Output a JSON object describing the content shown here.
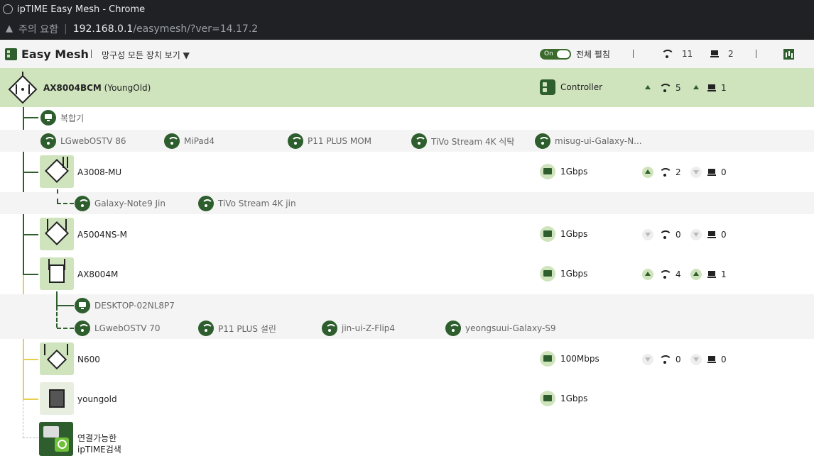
{
  "browser": {
    "window_title": "ipTIME Easy Mesh - Chrome",
    "security_label": "주의 요함",
    "url_host": "192.168.0.1",
    "url_path": "/easymesh/?ver=14.17.2"
  },
  "header": {
    "app_title": "Easy Mesh",
    "view_all_label": "망구성 모든 장치 보기 ▼",
    "toggle_label": "On",
    "expand_label": "전체 펼침",
    "wifi_total": "11",
    "wired_total": "2"
  },
  "controller": {
    "model": "AX8004BCM",
    "name": "(YoungOld)",
    "role": "Controller",
    "wifi_count": "5",
    "wired_count": "1"
  },
  "controller_clients": {
    "wired": [
      "복합기"
    ],
    "wifi": [
      "LGwebOSTV 86",
      "MiPad4",
      "P11 PLUS MOM",
      "TiVo Stream 4K 식탁",
      "misug-ui-Galaxy-N..."
    ]
  },
  "agents": [
    {
      "model": "A3008-MU",
      "link": "1Gbps",
      "wifi": "2",
      "wired": "0",
      "wifi_up": true,
      "wired_up": false,
      "clients_wired": [],
      "clients_wifi": [
        "Galaxy-Note9 Jin",
        "TiVo Stream 4K jin"
      ]
    },
    {
      "model": "A5004NS-M",
      "link": "1Gbps",
      "wifi": "0",
      "wired": "0",
      "wifi_up": false,
      "wired_up": false,
      "clients_wired": [],
      "clients_wifi": []
    },
    {
      "model": "AX8004M",
      "link": "1Gbps",
      "wifi": "4",
      "wired": "1",
      "wifi_up": true,
      "wired_up": true,
      "clients_wired": [
        "DESKTOP-02NL8P7"
      ],
      "clients_wifi": [
        "LGwebOSTV 70",
        "P11 PLUS 설린",
        "jin-ui-Z-Flip4",
        "yeongsuui-Galaxy-S9"
      ]
    },
    {
      "model": "N600",
      "link": "100Mbps",
      "wifi": "0",
      "wired": "0",
      "wifi_up": false,
      "wired_up": false,
      "clients_wired": [],
      "clients_wifi": []
    },
    {
      "model": "youngold",
      "link": "1Gbps"
    }
  ],
  "search": {
    "line1": "연결가능한",
    "line2": "ipTIME검색"
  },
  "icons": {
    "logo": "mesh-logo-icon",
    "wifi": "wifi-icon",
    "wired": "pc-icon",
    "chart": "chart-icon",
    "search": "search-icon"
  },
  "colors": {
    "accent_dark": "#2e5e2e",
    "accent_light": "#cfe3bd",
    "band_gray": "#f4f4f4",
    "yellow_line": "#e6d04e"
  }
}
